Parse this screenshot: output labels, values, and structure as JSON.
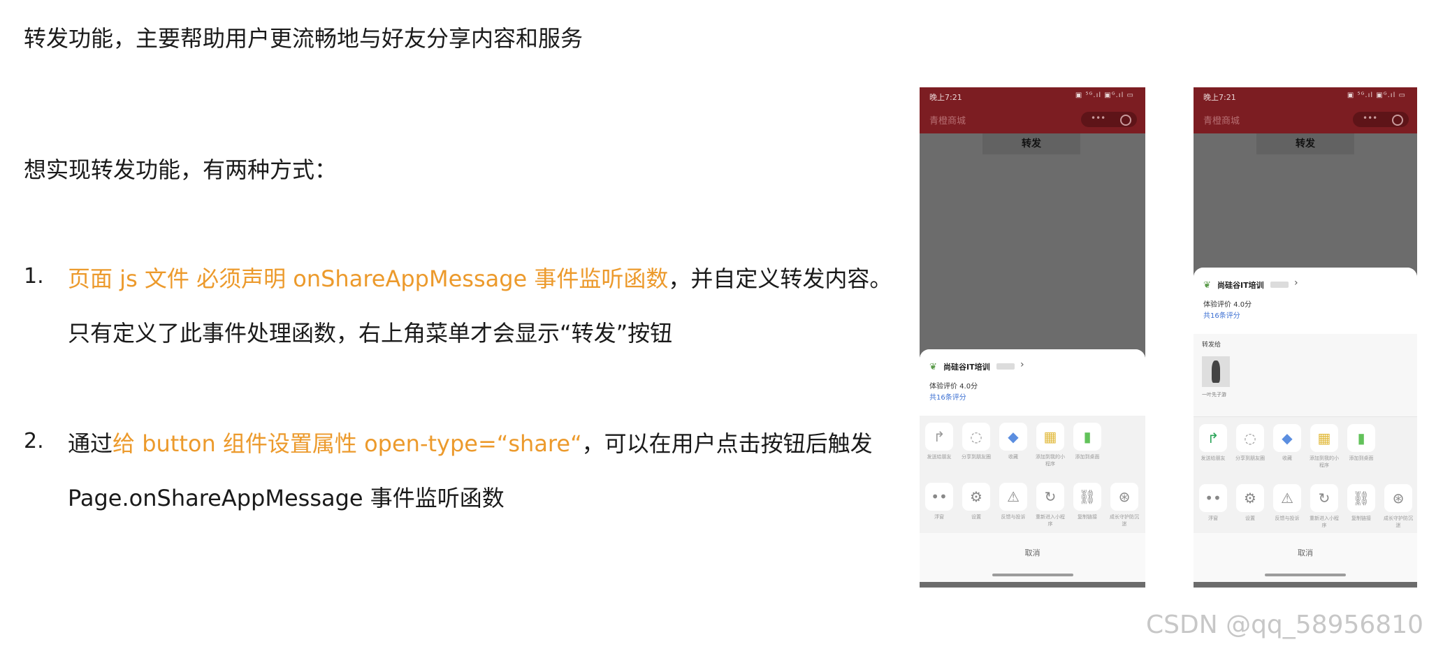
{
  "text": {
    "intro": "转发功能，主要帮助用户更流畅地与好友分享内容和服务",
    "ways": "想实现转发功能，有两种方式：",
    "item1": {
      "number": "1.",
      "highlight": "页面 js 文件 必须声明 onShareAppMessage 事件监听函数",
      "rest": "，并自定义转发内容。",
      "line2": "只有定义了此事件处理函数，右上角菜单才会显示“转发”按钮"
    },
    "item2": {
      "number": "2.",
      "prefix": "通过",
      "highlight": "给 button 组件设置属性 open-type=“share“",
      "rest": "，可以在用户点击按钮后触发",
      "line2": "Page.onShareAppMessage 事件监听函数"
    }
  },
  "phones": [
    {
      "time": "晚上7:21",
      "signal": "▣ ⁵ᴳ.ıl ▣ᴳ.ıl ▭",
      "app_name": "青橙商城",
      "capsule_dots": "•••",
      "share_button": "转发",
      "brand": "尚硅谷IT培训",
      "rating": "体验评价  4.0分",
      "rating_count": "共16条评分",
      "row1": [
        {
          "icon": "forward-icon",
          "glyph": "↱",
          "label": "发送给朋友",
          "color": "#9a9a9a"
        },
        {
          "icon": "moments-icon",
          "glyph": "◌",
          "label": "分享到朋友圈",
          "color": "#9a9a9a"
        },
        {
          "icon": "cube-icon",
          "glyph": "◆",
          "label": "收藏",
          "color": "#5b8ee0"
        },
        {
          "icon": "grid-icon",
          "glyph": "▦",
          "label": "添加到我的小程序",
          "color": "#e1b93a"
        },
        {
          "icon": "desktop-icon",
          "glyph": "▮",
          "label": "添加到桌面",
          "color": "#62c25a"
        }
      ],
      "row2": [
        {
          "icon": "more-icon",
          "glyph": "••",
          "label": "浮窗"
        },
        {
          "icon": "settings-icon",
          "glyph": "⚙",
          "label": "设置"
        },
        {
          "icon": "warning-icon",
          "glyph": "⚠",
          "label": "反馈与投诉"
        },
        {
          "icon": "refresh-icon",
          "glyph": "↻",
          "label": "重新进入小程序"
        },
        {
          "icon": "link-icon",
          "glyph": "⛓",
          "label": "复制链接"
        },
        {
          "icon": "protect-icon",
          "glyph": "⊛",
          "label": "成长守护防沉迷"
        }
      ],
      "cancel": "取消"
    },
    {
      "time": "晚上7:21",
      "signal": "▣ ⁵ᴳ.ıl ▣ᴳ.ıl ▭",
      "app_name": "青橙商城",
      "capsule_dots": "•••",
      "share_button": "转发",
      "brand": "尚硅谷IT培训",
      "rating": "体验评价  4.0分",
      "rating_count": "共16条评分",
      "friends_label": "转发给",
      "friend_name": "一叶先子游",
      "row1": [
        {
          "icon": "forward-icon",
          "glyph": "↱",
          "label": "发送给朋友",
          "color": "#2aa458"
        },
        {
          "icon": "moments-icon",
          "glyph": "◌",
          "label": "分享到朋友圈",
          "color": "#9a9a9a"
        },
        {
          "icon": "cube-icon",
          "glyph": "◆",
          "label": "收藏",
          "color": "#5b8ee0"
        },
        {
          "icon": "grid-icon",
          "glyph": "▦",
          "label": "添加到我的小程序",
          "color": "#e1b93a"
        },
        {
          "icon": "desktop-icon",
          "glyph": "▮",
          "label": "添加到桌面",
          "color": "#62c25a"
        }
      ],
      "row2": [
        {
          "icon": "more-icon",
          "glyph": "••",
          "label": "浮窗"
        },
        {
          "icon": "settings-icon",
          "glyph": "⚙",
          "label": "设置"
        },
        {
          "icon": "warning-icon",
          "glyph": "⚠",
          "label": "反馈与投诉"
        },
        {
          "icon": "refresh-icon",
          "glyph": "↻",
          "label": "重新进入小程序"
        },
        {
          "icon": "link-icon",
          "glyph": "⛓",
          "label": "复制链接"
        },
        {
          "icon": "protect-icon",
          "glyph": "⊛",
          "label": "成长守护防沉迷"
        }
      ],
      "cancel": "取消"
    }
  ],
  "watermark": "CSDN @qq_58956810"
}
